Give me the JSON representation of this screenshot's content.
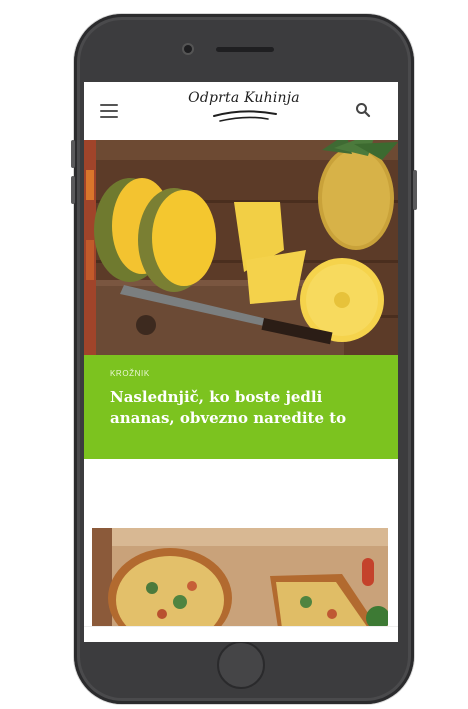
{
  "header": {
    "logo_text": "Odprta Kuhinja",
    "menu_icon": "hamburger-menu-icon",
    "search_icon": "search-icon"
  },
  "featured": {
    "category": "KROŽNIK",
    "title": "Naslednjič, ko boste jedli ananas, obvezno naredite to",
    "image": "pineapple-slices-photo"
  },
  "next_article": {
    "image": "quiche-photo"
  },
  "colors": {
    "accent_green": "#7cc31f",
    "phone_body": "#4a4a4c"
  }
}
